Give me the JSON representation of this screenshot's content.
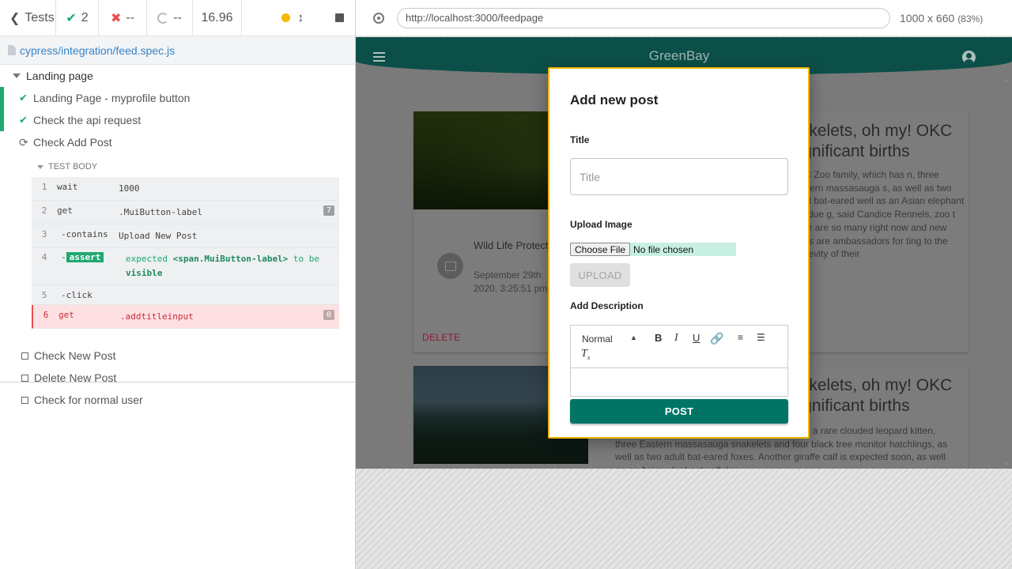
{
  "reporter": {
    "tests_label": "Tests",
    "passed_count": "2",
    "failed_count": "--",
    "pending_count": "--",
    "duration": "16.96",
    "spec_path": "cypress/integration/feed.spec.js",
    "suite_title": "Landing page",
    "tests": [
      {
        "title": "Landing Page - myprofile button",
        "state": "passed"
      },
      {
        "title": "Check the api request",
        "state": "passed"
      },
      {
        "title": "Check Add Post",
        "state": "running"
      }
    ],
    "test_body_label": "TEST BODY",
    "commands": [
      {
        "num": "1",
        "name": "wait",
        "message": "1000"
      },
      {
        "num": "2",
        "name": "get",
        "message": ".MuiButton-label",
        "badge": "7"
      },
      {
        "num": "3",
        "name": "-contains",
        "message": "Upload New Post"
      },
      {
        "num": "4",
        "name": "-",
        "assert_tag": "assert",
        "message_pre": "expected ",
        "message_strong": "<span.MuiButton-label>",
        "message_mid": " to be ",
        "message_end": "visible"
      },
      {
        "num": "5",
        "name": "-click",
        "message": ""
      },
      {
        "num": "6",
        "name": "get",
        "message": ".addtitleinput",
        "badge": "0",
        "state": "failed"
      }
    ],
    "pending_tests": [
      {
        "title": "Check New Post"
      },
      {
        "title": "Delete New Post"
      },
      {
        "title": "Check for normal user"
      }
    ]
  },
  "browser": {
    "url": "http://localhost:3000/feedpage",
    "viewport": "1000 x 660",
    "zoom": "(83%)"
  },
  "app": {
    "title": "GreenBay",
    "cards": [
      {
        "title_line1": "nakelets, oh my! OKC",
        "title_line2": "significant births",
        "text": "OKC Zoo family, which has n, three Eastern massasauga s, as well as two adult bat-eared well as an Asian elephant calf due g, said Candice Rennels, zoo t there are so many right now and new births are ambassadors for ting to the longevity of their",
        "author": "Wild Life Protection Ministry",
        "date": "September 29th 2020, 3:25:51 pm",
        "delete_label": "DELETE"
      },
      {
        "title_line1": "nakelets, oh my! OKC",
        "title_line2": "significant births",
        "text": "OKC Zoo family, which has recently welcomed a rare clouded leopard kitten, three Eastern massasauga snakelets and four black tree monitor hatchlings, as well as two adult bat-eared foxes. Another giraffe calf is expected soon, as well as an Asian elephant calf due"
      }
    ]
  },
  "dialog": {
    "title": "Add new post",
    "title_label": "Title",
    "title_placeholder": "Title",
    "upload_label": "Upload Image",
    "choose_file": "Choose File",
    "no_file": "No file chosen",
    "upload_button": "UPLOAD",
    "description_label": "Add Description",
    "editor_format": "Normal",
    "post_button": "POST"
  }
}
